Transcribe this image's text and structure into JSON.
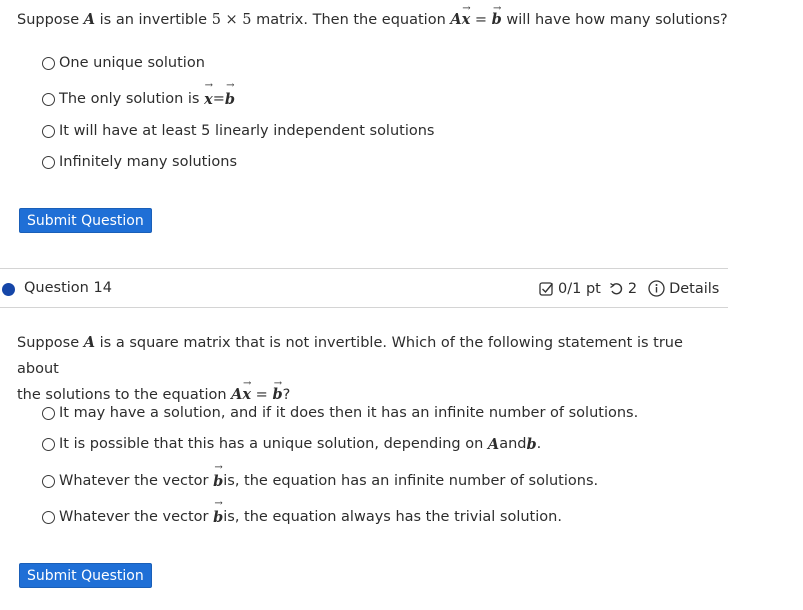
{
  "question13": {
    "text_a": "Suppose ",
    "math_A": "A",
    "text_b": " is an invertible ",
    "math_dims": "5 × 5",
    "text_c": " matrix. Then the equation ",
    "math_Ax": "Ax",
    "math_eq": " = ",
    "math_b": "b",
    "text_d": " will have how many solutions?",
    "options": [
      "One unique solution",
      "The only solution is",
      "It will have at least 5 linearly independent solutions",
      "Infinitely many solutions"
    ],
    "option2_math_x": "x",
    "option2_math_eq": " = ",
    "option2_math_b": "b",
    "submit_label": "Submit Question"
  },
  "question14": {
    "title": "Question 14",
    "score": "0/1 pt",
    "retries": "2",
    "details_label": "Details",
    "text_a": "Suppose ",
    "math_A": "A",
    "text_b": " is a square matrix that is not invertible. Which of the following statement is true about",
    "text_c": "the solutions to the equation ",
    "math_Ax": "Ax",
    "math_eq": " = ",
    "math_b": "b",
    "text_d": "?",
    "options": [
      "It may have a solution, and if it does then it has an infinite number of solutions.",
      "It is possible that this has a unique solution, depending on",
      "Whatever the vector",
      "Whatever the vector"
    ],
    "option2_math_A": "A",
    "option2_and": " and ",
    "option2_math_b": "b",
    "option2_end": ".",
    "option3_math_b": "b",
    "option3_rest": " is, the equation has an infinite number of solutions.",
    "option4_math_b": "b",
    "option4_rest": " is, the equation always has the trivial solution.",
    "submit_label": "Submit Question"
  },
  "colors": {
    "button": "#1f6fd6",
    "question_dot": "#1546a8",
    "divider": "#d4d4d4"
  }
}
